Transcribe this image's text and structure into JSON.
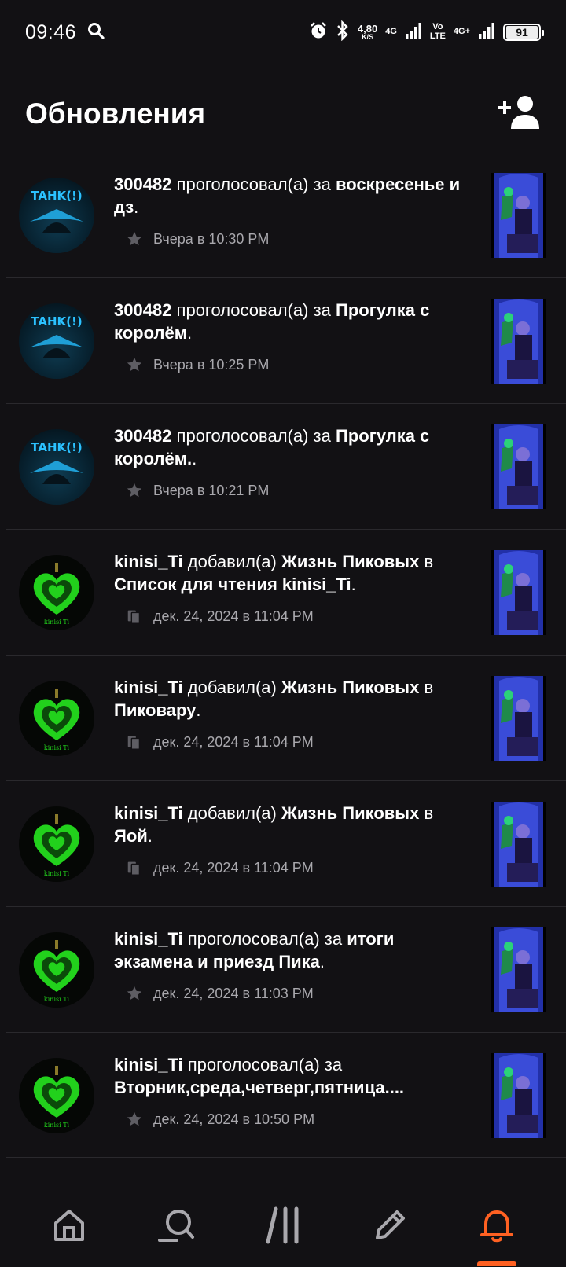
{
  "status_bar": {
    "time": "09:46",
    "net_speed_value": "4,80",
    "net_speed_unit": "K/S",
    "net1": "4G",
    "volte_top": "Vo",
    "volte_bottom": "LTE",
    "net2": "4G+",
    "battery": "91"
  },
  "header": {
    "title": "Обновления",
    "add_user_icon": "add-user-icon"
  },
  "feed": [
    {
      "user": "300482",
      "action": "проголосовал(а) за",
      "target": "воскресенье и дз",
      "tail": ".",
      "mid": "",
      "list": "",
      "meta_icon": "star",
      "time": "Вчера в 10:30 PM",
      "avatar": "a"
    },
    {
      "user": "300482",
      "action": "проголосовал(а) за",
      "target": "Прогулка с королём",
      "tail": ".",
      "mid": "",
      "list": "",
      "meta_icon": "star",
      "time": "Вчера в 10:25 PM",
      "avatar": "a"
    },
    {
      "user": "300482",
      "action": "проголосовал(а) за",
      "target": "Прогулка с королём.",
      "tail": ".",
      "mid": "",
      "list": "",
      "meta_icon": "star",
      "time": "Вчера в 10:21 PM",
      "avatar": "a"
    },
    {
      "user": "kinisi_Ti",
      "action": "добавил(а)",
      "target": "Жизнь Пиковых",
      "mid": "в",
      "list": "Список для чтения kinisi_Ti",
      "tail": ".",
      "meta_icon": "reading-list",
      "time": "дек. 24, 2024 в 11:04 PM",
      "avatar": "b"
    },
    {
      "user": "kinisi_Ti",
      "action": "добавил(а)",
      "target": "Жизнь Пиковых",
      "mid": "в",
      "list": "Пиковару",
      "tail": ".",
      "meta_icon": "reading-list",
      "time": "дек. 24, 2024 в 11:04 PM",
      "avatar": "b"
    },
    {
      "user": "kinisi_Ti",
      "action": "добавил(а)",
      "target": "Жизнь Пиковых",
      "mid": "в",
      "list": "Яой",
      "tail": ".",
      "meta_icon": "reading-list",
      "time": "дек. 24, 2024 в 11:04 PM",
      "avatar": "b"
    },
    {
      "user": "kinisi_Ti",
      "action": "проголосовал(а) за",
      "target": "итоги экзамена и приезд Пика",
      "tail": ".",
      "mid": "",
      "list": "",
      "meta_icon": "star",
      "time": "дек. 24, 2024 в 11:03 PM",
      "avatar": "b"
    },
    {
      "user": "kinisi_Ti",
      "action": "проголосовал(а) за",
      "target": "Вторник,среда,четверг,пятница....",
      "tail": "",
      "mid": "",
      "list": "",
      "meta_icon": "star",
      "time": "дек. 24, 2024 в 10:50 PM",
      "avatar": "b"
    }
  ],
  "avatar_text": {
    "a": "TAHK(!)",
    "b": "kinisi Ti"
  },
  "bottom_nav": [
    {
      "name": "home",
      "icon": "home-icon",
      "active": false
    },
    {
      "name": "search",
      "icon": "search-icon",
      "active": false
    },
    {
      "name": "library",
      "icon": "library-icon",
      "active": false
    },
    {
      "name": "write",
      "icon": "pencil-icon",
      "active": false
    },
    {
      "name": "notifications",
      "icon": "bell-icon",
      "active": true
    }
  ],
  "colors": {
    "background": "#121114",
    "accent": "#ff6122",
    "meta_text": "#a9a8ad",
    "divider": "#2a292d"
  }
}
